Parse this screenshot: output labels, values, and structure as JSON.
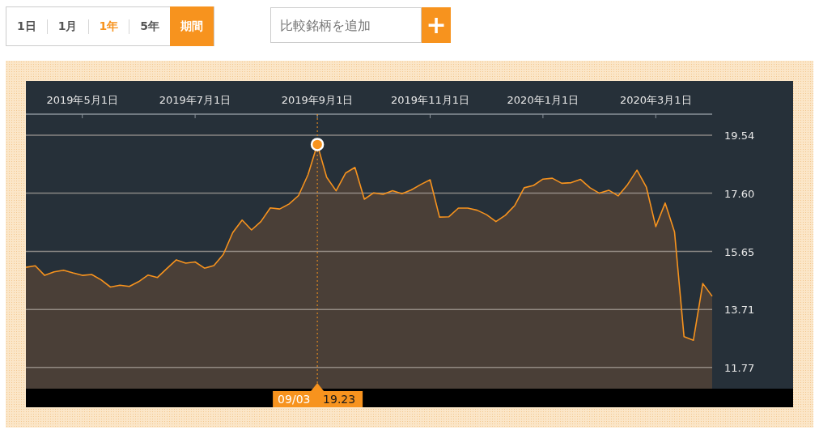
{
  "ranges": [
    {
      "label": "1日",
      "selected": false
    },
    {
      "label": "1月",
      "selected": false
    },
    {
      "label": "1年",
      "selected": true
    },
    {
      "label": "5年",
      "selected": false
    }
  ],
  "period_button": {
    "label": "期間"
  },
  "compare": {
    "placeholder": "比較銘柄を追加",
    "add_button": "+"
  },
  "chart": {
    "tooltip": {
      "date": "09/03",
      "value": "19.23"
    },
    "chart_data": {
      "type": "area",
      "grid": true,
      "ylim": [
        11.06,
        20.27
      ],
      "categories": [
        null,
        null,
        null,
        null,
        null,
        null,
        "2019年5月1日",
        null,
        null,
        null,
        null,
        null,
        null,
        null,
        null,
        null,
        null,
        null,
        "2019年7月1日",
        null,
        null,
        null,
        null,
        null,
        null,
        null,
        null,
        null,
        null,
        null,
        null,
        "2019年9月1日",
        null,
        null,
        null,
        null,
        null,
        null,
        null,
        null,
        null,
        null,
        null,
        "2019年11月1日",
        null,
        null,
        null,
        null,
        null,
        null,
        null,
        null,
        null,
        null,
        null,
        "2020年1月1日",
        null,
        null,
        null,
        null,
        null,
        null,
        null,
        null,
        null,
        null,
        null,
        "2020年3月1日",
        null,
        null,
        null,
        null,
        null,
        null
      ],
      "yticks": [
        {
          "value": 19.54,
          "label": "19.54"
        },
        {
          "value": 17.6,
          "label": "17.60"
        },
        {
          "value": 15.65,
          "label": "15.65"
        },
        {
          "value": 13.71,
          "label": "13.71"
        },
        {
          "value": 11.77,
          "label": "11.77"
        }
      ],
      "series": [
        {
          "color": "#f7931e",
          "values": [
            15.12,
            15.17,
            14.85,
            14.97,
            15.02,
            14.93,
            14.85,
            14.88,
            14.7,
            14.46,
            14.52,
            14.48,
            14.64,
            14.86,
            14.78,
            15.08,
            15.37,
            15.26,
            15.3,
            15.09,
            15.18,
            15.55,
            16.28,
            16.7,
            16.37,
            16.65,
            17.11,
            17.07,
            17.24,
            17.52,
            18.21,
            19.23,
            18.13,
            17.68,
            18.27,
            18.46,
            17.4,
            17.61,
            17.56,
            17.68,
            17.58,
            17.71,
            17.89,
            18.05,
            16.8,
            16.81,
            17.1,
            17.1,
            17.03,
            16.88,
            16.65,
            16.86,
            17.19,
            17.78,
            17.86,
            18.07,
            18.1,
            17.93,
            17.95,
            18.06,
            17.78,
            17.6,
            17.7,
            17.51,
            17.89,
            18.37,
            17.8,
            16.48,
            17.27,
            16.3,
            12.8,
            12.68,
            14.58,
            14.15
          ]
        }
      ]
    }
  }
}
